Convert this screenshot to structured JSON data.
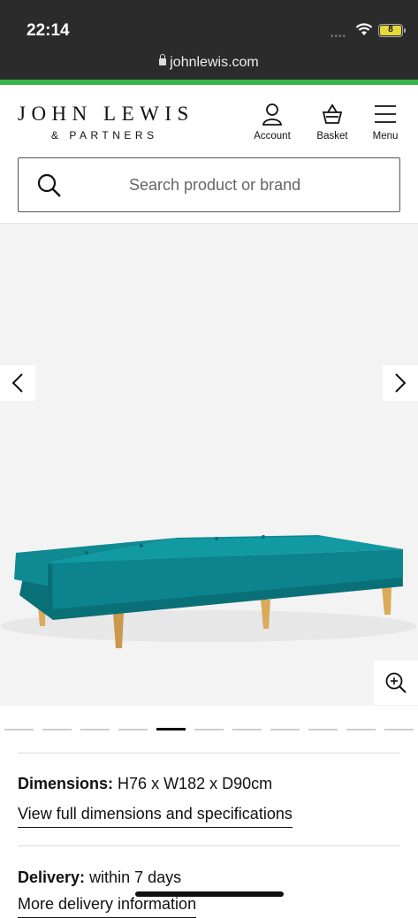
{
  "status": {
    "time": "22:14",
    "battery": "8"
  },
  "browser": {
    "url": "johnlewis.com"
  },
  "header": {
    "logo_main": "JOHN LEWIS",
    "logo_sub": "& PARTNERS",
    "account_label": "Account",
    "basket_label": "Basket",
    "menu_label": "Menu"
  },
  "search": {
    "placeholder": "Search product or brand"
  },
  "gallery": {
    "image_count": 11,
    "active_index": 5,
    "colors": {
      "sofa": "#0f8a93",
      "legs": "#d9ab5a",
      "background": "#f3f3f3"
    }
  },
  "details": {
    "dimensions_label": "Dimensions:",
    "dimensions_value": "H76 x W182 x D90cm",
    "dimensions_link": "View full dimensions and specifications",
    "delivery_label": "Delivery:",
    "delivery_value": "within 7 days",
    "delivery_link": "More delivery information"
  },
  "colors": {
    "brand_green": "#3ab54a",
    "status_bg": "#2b2b2b"
  }
}
